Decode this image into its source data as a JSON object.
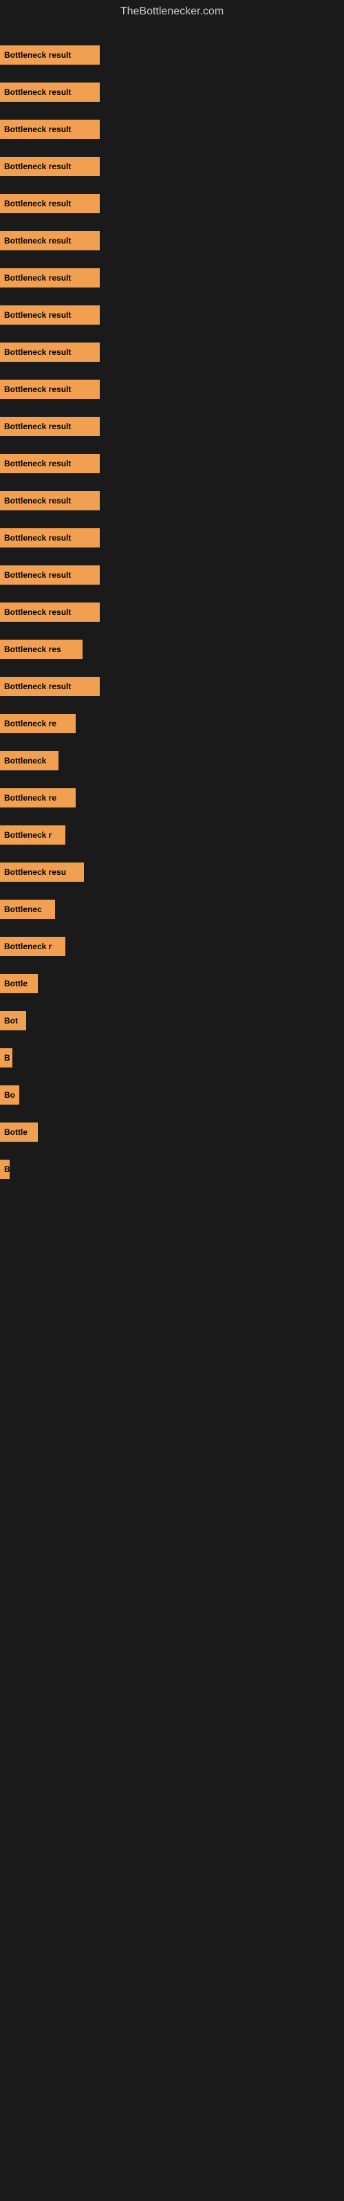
{
  "site": {
    "title": "TheBottlenecker.com"
  },
  "bars": [
    {
      "label": "Bottleneck result",
      "width": 145
    },
    {
      "label": "Bottleneck result",
      "width": 145
    },
    {
      "label": "Bottleneck result",
      "width": 145
    },
    {
      "label": "Bottleneck result",
      "width": 145
    },
    {
      "label": "Bottleneck result",
      "width": 145
    },
    {
      "label": "Bottleneck result",
      "width": 145
    },
    {
      "label": "Bottleneck result",
      "width": 145
    },
    {
      "label": "Bottleneck result",
      "width": 145
    },
    {
      "label": "Bottleneck result",
      "width": 145
    },
    {
      "label": "Bottleneck result",
      "width": 145
    },
    {
      "label": "Bottleneck result",
      "width": 145
    },
    {
      "label": "Bottleneck result",
      "width": 145
    },
    {
      "label": "Bottleneck result",
      "width": 145
    },
    {
      "label": "Bottleneck result",
      "width": 145
    },
    {
      "label": "Bottleneck result",
      "width": 145
    },
    {
      "label": "Bottleneck result",
      "width": 145
    },
    {
      "label": "Bottleneck res",
      "width": 120
    },
    {
      "label": "Bottleneck result",
      "width": 145
    },
    {
      "label": "Bottleneck re",
      "width": 110
    },
    {
      "label": "Bottleneck",
      "width": 85
    },
    {
      "label": "Bottleneck re",
      "width": 110
    },
    {
      "label": "Bottleneck r",
      "width": 95
    },
    {
      "label": "Bottleneck resu",
      "width": 122
    },
    {
      "label": "Bottlenec",
      "width": 80
    },
    {
      "label": "Bottleneck r",
      "width": 95
    },
    {
      "label": "Bottle",
      "width": 55
    },
    {
      "label": "Bot",
      "width": 38
    },
    {
      "label": "B",
      "width": 18
    },
    {
      "label": "Bo",
      "width": 28
    },
    {
      "label": "Bottle",
      "width": 55
    },
    {
      "label": "B",
      "width": 14
    }
  ]
}
